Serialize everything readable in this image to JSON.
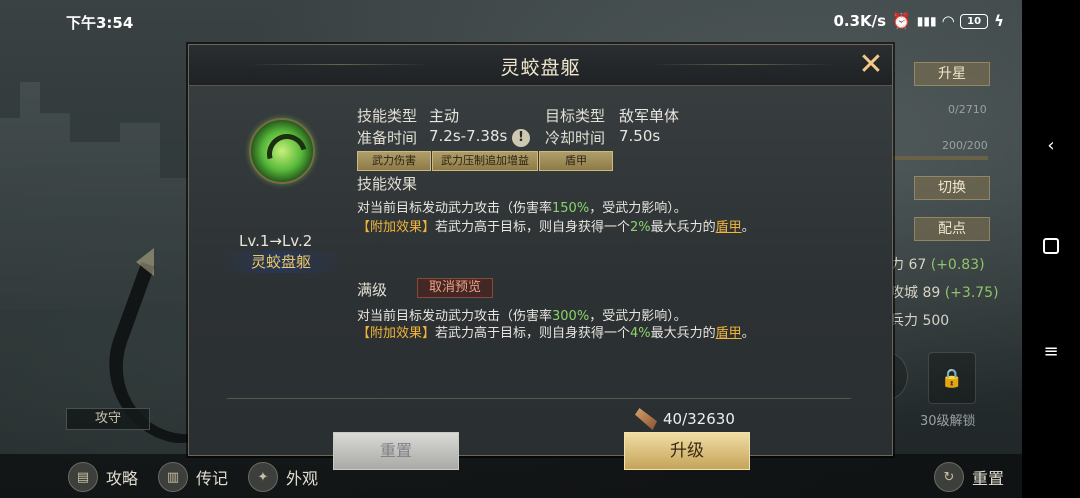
{
  "status_bar": {
    "time": "下午3:54",
    "net_speed": "0.3K/s",
    "battery": "10"
  },
  "background": {
    "right_panel": {
      "star_up": "升星",
      "progress_1": "0/2710",
      "progress_2": "200/200",
      "switch": "切换",
      "points": "配点",
      "stats": [
        {
          "label": "力 67",
          "plus": "(+0.83)"
        },
        {
          "label": "攻城 89",
          "plus": "(+3.75)"
        },
        {
          "label": "兵力 500",
          "plus": ""
        }
      ],
      "unlock_label": "30级解锁"
    },
    "attack_defense_label": "攻守"
  },
  "bottom_bar": {
    "strategy": "攻略",
    "biography": "传记",
    "appearance": "外观",
    "reset": "重置"
  },
  "dialog": {
    "title": "灵蛟盘躯",
    "skill": {
      "icon": "dragon-slash-icon",
      "level": "Lv.1→Lv.2",
      "name": "灵蛟盘躯"
    },
    "info": {
      "type_label": "技能类型",
      "type_value": "主动",
      "target_label": "目标类型",
      "target_value": "敌军单体",
      "prep_label": "准备时间",
      "prep_value": "7.2s-7.38s",
      "cooldown_label": "冷却时间",
      "cooldown_value": "7.50s"
    },
    "tags": [
      "武力伤害",
      "武力压制追加增益",
      "盾甲"
    ],
    "effect_label": "技能效果",
    "current": {
      "line1_a": "对当前目标发动武力攻击（伤害率",
      "line1_rate": "150%",
      "line1_b": "，受武力影响）。",
      "extra_tag": "【附加效果】",
      "line2_a": "若武力高于目标，则自身获得一个",
      "line2_pct": "2%",
      "line2_b": "最大兵力的",
      "line2_shield": "盾甲",
      "line2_end": "。"
    },
    "max_label": "满级",
    "cancel_preview": "取消预览",
    "max": {
      "line1_a": "对当前目标发动武力攻击（伤害率",
      "line1_rate": "300%",
      "line1_b": "，受武力影响）。",
      "extra_tag": "【附加效果】",
      "line2_a": "若武力高于目标，则自身获得一个",
      "line2_pct": "4%",
      "line2_b": "最大兵力的",
      "line2_shield": "盾甲",
      "line2_end": "。"
    },
    "cost": "40/32630",
    "reset_button": "重置",
    "upgrade_button": "升级"
  }
}
